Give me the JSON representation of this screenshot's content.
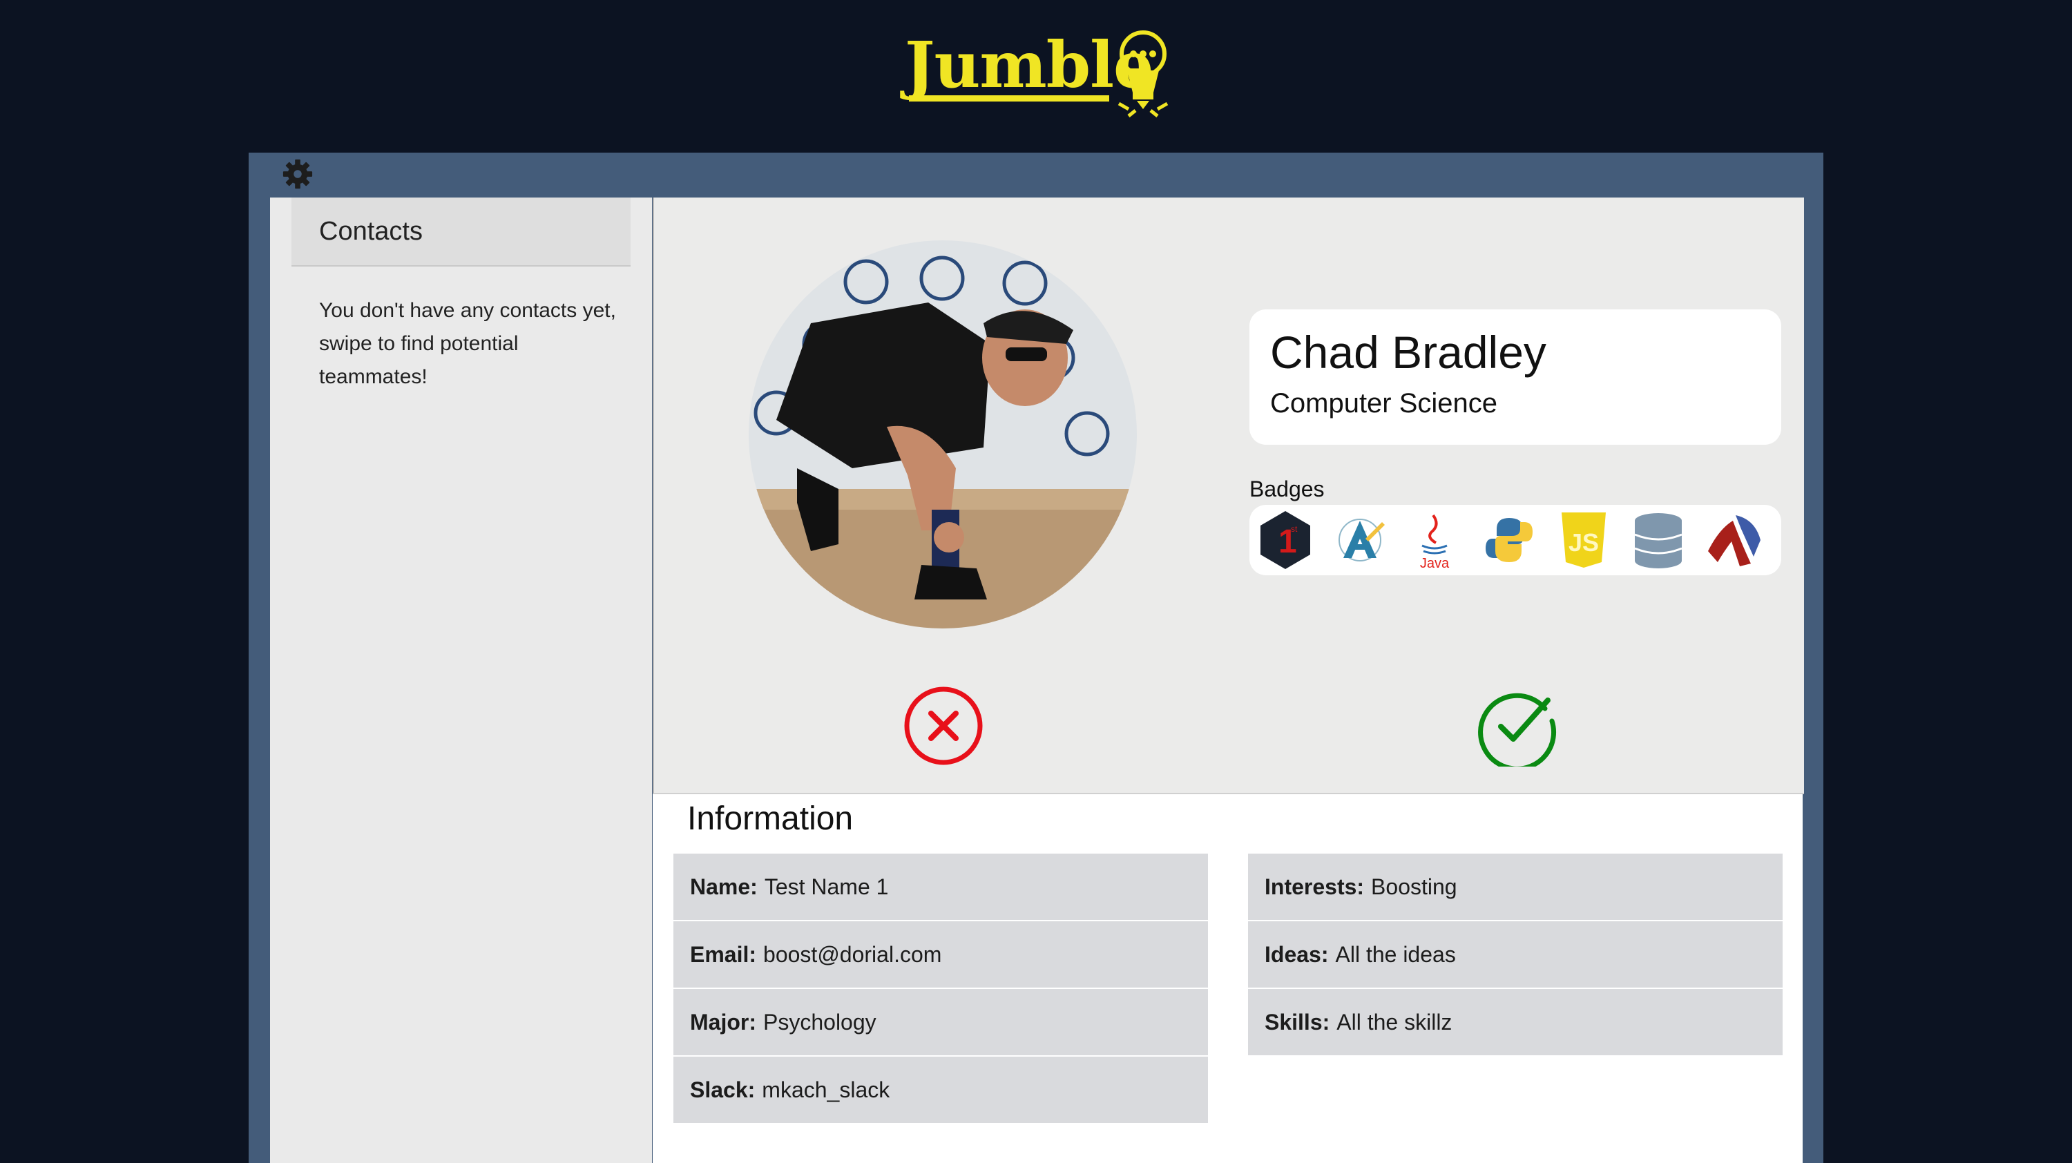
{
  "app": {
    "logo_text": "Jumble"
  },
  "contacts": {
    "title": "Contacts",
    "empty_message": "You don't have any contacts yet, swipe to find potential teammates!"
  },
  "profile": {
    "name": "Chad Bradley",
    "major": "Computer Science",
    "badges_label": "Badges",
    "badges": [
      {
        "icon": "first-place-badge-icon"
      },
      {
        "icon": "android-studio-badge-icon"
      },
      {
        "icon": "java-badge-icon",
        "label": "Java"
      },
      {
        "icon": "python-badge-icon"
      },
      {
        "icon": "javascript-badge-icon",
        "label": "JS"
      },
      {
        "icon": "database-badge-icon"
      },
      {
        "icon": "racket-badge-icon"
      }
    ]
  },
  "actions": {
    "reject_icon": "x-circle-icon",
    "accept_icon": "check-circle-icon"
  },
  "information": {
    "title": "Information",
    "left": [
      {
        "label": "Name:",
        "value": "Test Name 1"
      },
      {
        "label": "Email:",
        "value": "boost@dorial.com"
      },
      {
        "label": "Major:",
        "value": "Psychology"
      },
      {
        "label": "Slack:",
        "value": "mkach_slack"
      }
    ],
    "right": [
      {
        "label": "Interests:",
        "value": "Boosting"
      },
      {
        "label": "Ideas:",
        "value": "All the ideas"
      },
      {
        "label": "Skills:",
        "value": "All the skillz"
      }
    ]
  },
  "colors": {
    "background": "#0c1322",
    "frame": "#445c7a",
    "brand_yellow": "#f0e524",
    "reject": "#e8101a",
    "accept": "#0a8a12"
  }
}
